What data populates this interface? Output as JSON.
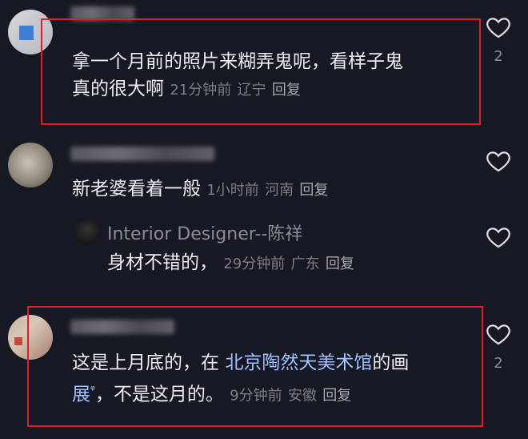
{
  "comments": [
    {
      "text_line1": "拿一个月前的照片来糊弄鬼呢，看样子鬼",
      "text_line2": "真的很大啊",
      "time": "21分钟前",
      "location": "辽宁",
      "reply_label": "回复",
      "like_count": "2"
    },
    {
      "text": "新老婆看着一般",
      "time": "1小时前",
      "location": "河南",
      "reply_label": "回复"
    },
    {
      "author": "Interior Designer--陈祥",
      "text": "身材不错的，",
      "time": "29分钟前",
      "location": "广东",
      "reply_label": "回复"
    },
    {
      "text_line1_a": "这是上月底的，在 ",
      "text_line1_link": "北京陶然天美术馆",
      "text_line1_b": "的画",
      "text_line2_link": "展",
      "text_line2_rest": "，不是这月的。",
      "search_glyph": "ᵠ",
      "time": "9分钟前",
      "location": "安徽",
      "reply_label": "回复",
      "like_count": "2"
    }
  ],
  "icons": {
    "like": "heart-outline-icon"
  },
  "colors": {
    "highlight": "#e21d24",
    "background": "#161823",
    "link": "#9fc1ff"
  }
}
